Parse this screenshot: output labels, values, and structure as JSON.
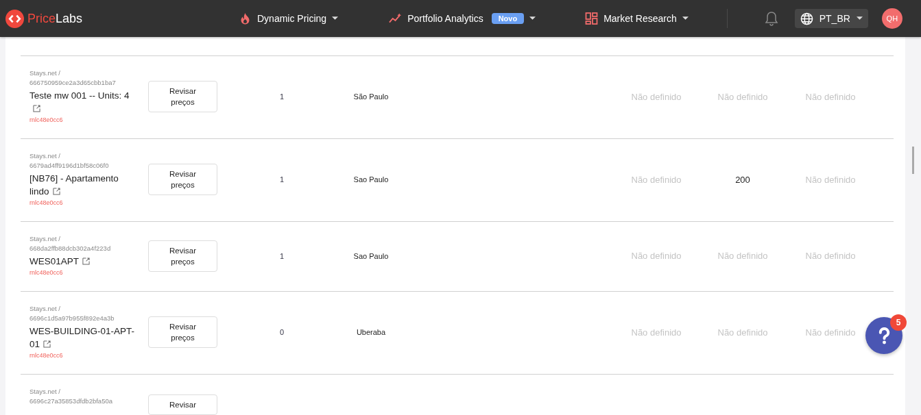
{
  "brand": {
    "first": "Price",
    "second": "Labs"
  },
  "nav": [
    {
      "label": "Dynamic Pricing",
      "kind": "flame"
    },
    {
      "label": "Portfolio Analytics",
      "kind": "trend",
      "badge": "Novo"
    },
    {
      "label": "Market Research",
      "kind": "grid"
    }
  ],
  "locale": "PT_BR",
  "avatar": "QH",
  "rows": [
    {
      "source": "Stays.net /",
      "listing_id": "666750959ce2a3d65cbb1ba7",
      "name": "Teste mw 001 -- Units: 4",
      "code": "rnlc48e0cc6",
      "button": "Revisar preços",
      "count": "1",
      "city": "São Paulo",
      "values": [
        {
          "text": "Não definido",
          "defined": false
        },
        {
          "text": "Não definido",
          "defined": false
        },
        {
          "text": "Não definido",
          "defined": false
        }
      ]
    },
    {
      "source": "Stays.net /",
      "listing_id": "6679ad4ff9196d1bf58c06f0",
      "name": "[NB76] - Apartamento lindo",
      "code": "rnlc48e0cc6",
      "button": "Revisar preços",
      "count": "1",
      "city": "Sao Paulo",
      "values": [
        {
          "text": "Não definido",
          "defined": false
        },
        {
          "text": "200",
          "defined": true
        },
        {
          "text": "Não definido",
          "defined": false
        }
      ]
    },
    {
      "source": "Stays.net /",
      "listing_id": "668da2ffb88dcb302a4f223d",
      "name": "WES01APT",
      "code": "rnlc48e0cc6",
      "button": "Revisar preços",
      "count": "1",
      "city": "Sao Paulo",
      "values": [
        {
          "text": "Não definido",
          "defined": false
        },
        {
          "text": "Não definido",
          "defined": false
        },
        {
          "text": "Não definido",
          "defined": false
        }
      ]
    },
    {
      "source": "Stays.net /",
      "listing_id": "6696c1d5a97b955f892e4a3b",
      "name": "WES-BUILDING-01-APT-01",
      "code": "rnlc48e0cc6",
      "button": "Revisar preços",
      "count": "0",
      "city": "Uberaba",
      "values": [
        {
          "text": "Não definido",
          "defined": false
        },
        {
          "text": "Não definido",
          "defined": false
        },
        {
          "text": "Não definido",
          "defined": false
        }
      ]
    },
    {
      "source": "Stays.net /",
      "listing_id": "6696c27a35853dfdb2bfa50a",
      "button": "Revisar"
    }
  ],
  "help": {
    "badge": "5"
  }
}
